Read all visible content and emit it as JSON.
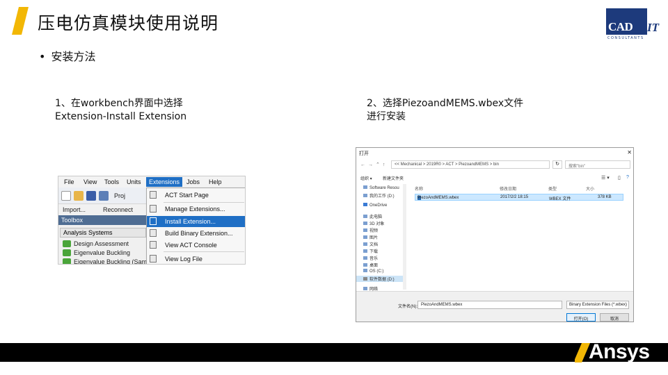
{
  "slide": {
    "title": "压电仿真模块使用说明",
    "bullet": "安装方法",
    "step1_line1": "1、在workbench界面中选择",
    "step1_line2": "Extension-Install Extension",
    "step2_line1": "2、选择PiezoandMEMS.wbex文件",
    "step2_line2": "进行安装",
    "accent_color": "#f2b705"
  },
  "logos": {
    "cadit_main": "CAD",
    "cadit_it": "IT",
    "cadit_sub": "CONSULTANTS",
    "ansys": "Ansys"
  },
  "workbench": {
    "menu": [
      "File",
      "View",
      "Tools",
      "Units",
      "Extensions",
      "Jobs",
      "Help"
    ],
    "toolbar_project": "Proj",
    "toolbar2": [
      "Import...",
      "Reconnect"
    ],
    "toolbox_header": "Toolbox",
    "analysis_systems": "Analysis Systems",
    "systems": [
      "Design Assessment",
      "Eigenvalue Buckling",
      "Eigenvalue Buckling (Samc"
    ],
    "dropdown": [
      {
        "label": "ACT Start Page",
        "icon": "grid-icon"
      },
      {
        "label": "Manage Extensions...",
        "icon": "extensions-icon"
      },
      {
        "label": "Install Extension...",
        "icon": "plus-icon",
        "selected": true
      },
      {
        "label": "Build Binary Extension...",
        "icon": "build-icon"
      },
      {
        "label": "View ACT Console",
        "icon": "console-icon"
      },
      {
        "label": "View Log File",
        "icon": "log-icon"
      }
    ],
    "menu_highlight_color": "#1f6fc5"
  },
  "file_dialog": {
    "title": "打开",
    "path": "<< Mechanical > 2019R0 > ACT > PiezoandMEMS > bin",
    "search_placeholder": "搜索\"bin\"",
    "cmd_organize": "组织 ▾",
    "cmd_newfolder": "新建文件夹",
    "nav_items": [
      "Software Resou",
      "我的工作 (D:)",
      "OneDrive",
      "此电脑",
      "3D 对象",
      "视频",
      "图片",
      "文档",
      "下载",
      "音乐",
      "桌面",
      "OS (C:)",
      "软件数据 (D:)",
      "网络"
    ],
    "columns": [
      "名称",
      "修改日期",
      "类型",
      "大小"
    ],
    "file": {
      "name": "PiezoAndMEMS.wbex",
      "date": "2017/2/2 18:15",
      "type": "WBEX 文件",
      "size": "378 KB"
    },
    "filename_label": "文件名(N):",
    "filename_value": "PiezoAndMEMS.wbex",
    "filetype": "Binary Extension Files (*.wbex)",
    "open_button": "打开(O)",
    "cancel_button": "取消"
  }
}
